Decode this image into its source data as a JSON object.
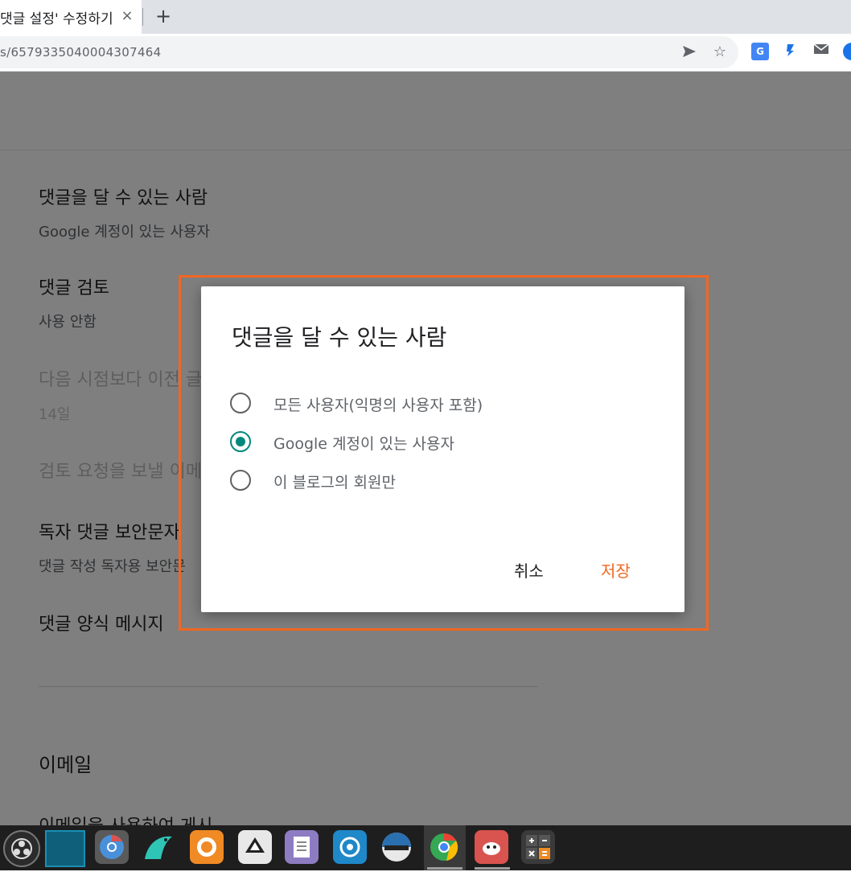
{
  "browser": {
    "tab_title": "댓글 설정' 수정하기",
    "tab_close": "×",
    "new_tab": "+",
    "url": "s/6579335040004307464",
    "icons": [
      "send-icon",
      "star-icon",
      "google-translate-icon",
      "extension-icon",
      "mail-icon",
      "globe-icon"
    ]
  },
  "page": {
    "sections": [
      {
        "title": "댓글을 달 수 있는 사람",
        "value": "Google 계정이 있는 사용자"
      },
      {
        "title": "댓글 검토",
        "value": "사용 안함"
      },
      {
        "title": "다음 시점보다 이전 글",
        "value": "14일"
      },
      {
        "title": "검토 요청을 보낼 이메"
      },
      {
        "title": "독자 댓글 보안문자",
        "value": "댓글 작성 독자용 보안문"
      },
      {
        "title": "댓글 양식 메시지"
      },
      {
        "title": "이메일"
      },
      {
        "title": "이메일을 사용하여 게시"
      }
    ]
  },
  "dialog": {
    "title": "댓글을 달 수 있는 사람",
    "options": [
      {
        "label": "모든 사용자(익명의 사용자 포함)",
        "checked": false
      },
      {
        "label": "Google 계정이 있는 사용자",
        "checked": true
      },
      {
        "label": "이 블로그의 회원만",
        "checked": false
      }
    ],
    "cancel_label": "취소",
    "save_label": "저장",
    "accent_color": "#f26722",
    "radio_color": "#00897b"
  },
  "taskbar": {
    "apps": [
      "obs-icon",
      "window-icon",
      "chromium-icon",
      "bird-app-icon",
      "firefox-icon",
      "inkscape-icon",
      "text-editor-icon",
      "shutter-icon",
      "openshot-icon",
      "chrome-icon",
      "gimp-icon",
      "calculator-icon"
    ]
  }
}
